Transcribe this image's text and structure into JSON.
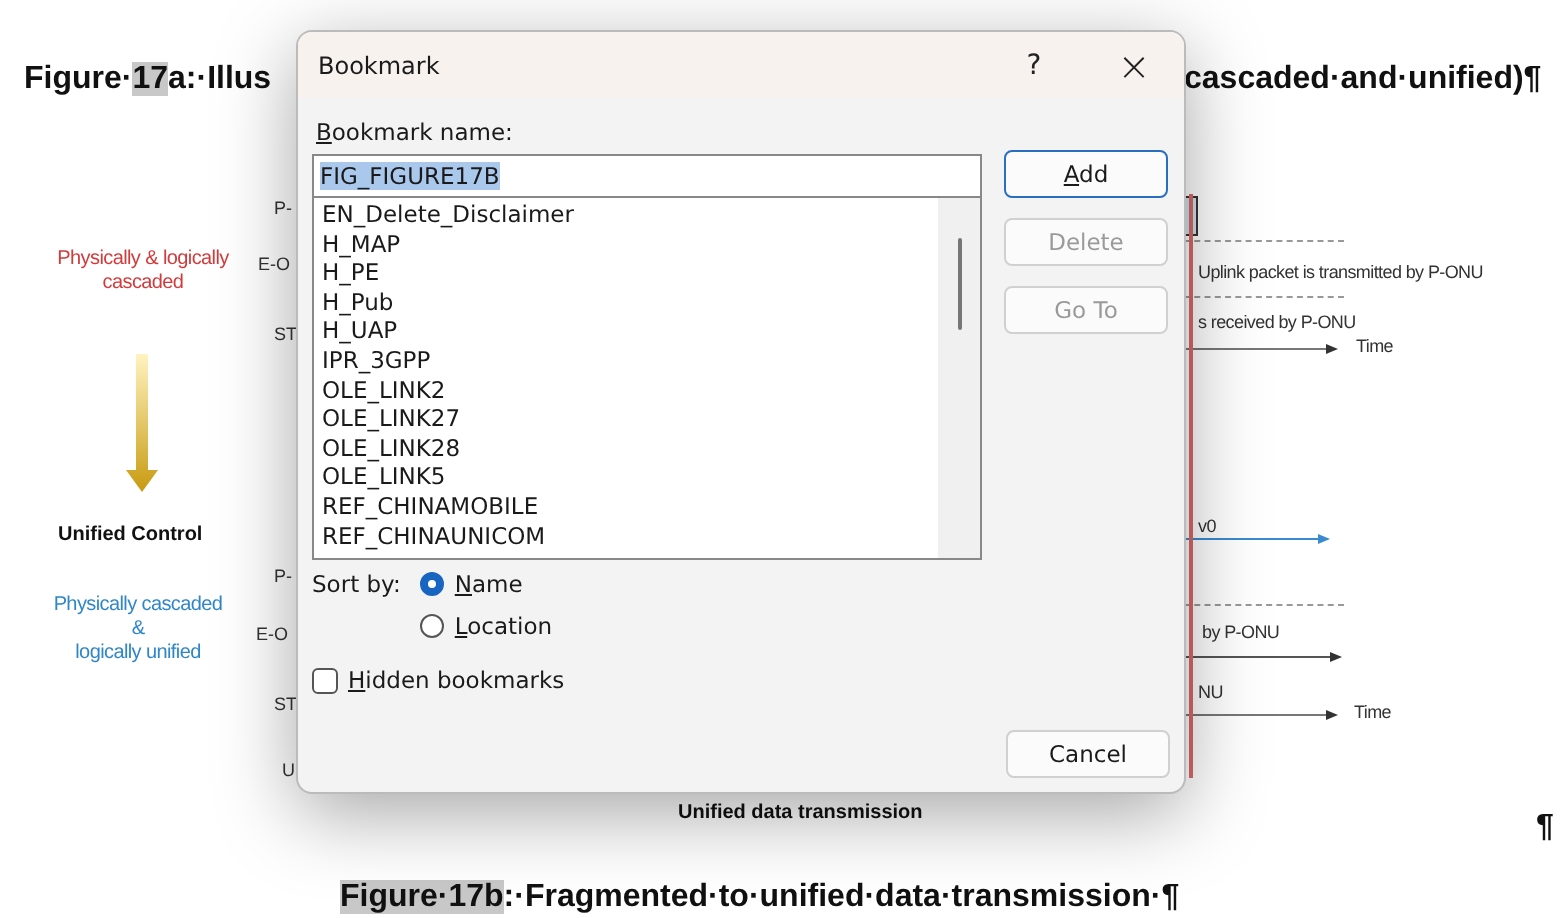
{
  "document": {
    "heading_left": [
      {
        "text": "Figure·",
        "highlighted": false
      },
      {
        "text": "17",
        "highlighted": true
      },
      {
        "text": "a:·Illus",
        "highlighted": false
      }
    ],
    "heading_right": "cascaded·and·unified)¶",
    "red_note": "Physically & logically\ncascaded",
    "unified_control": "Unified Control",
    "blue_note": "Physically cascaded\n&\nlogically unified",
    "upper_row_labels": [
      "P-",
      "E-O",
      "ST"
    ],
    "lower_row_labels": [
      "P-",
      "E-O",
      "ST",
      "U"
    ],
    "upper_notes": [
      "Uplink packet is transmitted by P-ONU",
      "s received by P-ONU"
    ],
    "upper_time": "Time",
    "lower_notes": [
      "v0",
      "by P-ONU",
      "NU"
    ],
    "lower_time": "Time",
    "figure_title": "Unified data transmission",
    "pilcrow": "¶",
    "caption": [
      {
        "text": "Figure·17b",
        "highlighted": true
      },
      {
        "text": ":·Fragmented·to·unified·data·transmission·¶",
        "highlighted": false
      }
    ]
  },
  "dialog": {
    "title": "Bookmark",
    "help": "?",
    "close": "×",
    "name_label": [
      "B",
      "ookmark name:"
    ],
    "name_field": {
      "value": "FIG_FIGURE17B",
      "text_selected": true
    },
    "bookmarks": [
      "EN_Delete_Disclaimer",
      "H_MAP",
      "H_PE",
      "H_Pub",
      "H_UAP",
      "IPR_3GPP",
      "OLE_LINK2",
      "OLE_LINK27",
      "OLE_LINK28",
      "OLE_LINK5",
      "REF_CHINAMOBILE",
      "REF_CHINAUNICOM"
    ],
    "buttons": [
      {
        "label": [
          "A",
          "dd"
        ],
        "disabled": false,
        "default": true
      },
      {
        "label": [
          "Delete"
        ],
        "disabled": true,
        "default": false
      },
      {
        "label": [
          "Go To"
        ],
        "disabled": true,
        "default": false
      }
    ],
    "sort_label": "Sort by:",
    "sort_options": [
      {
        "label": [
          "N",
          "ame"
        ],
        "selected": true
      },
      {
        "label": [
          "L",
          "ocation"
        ],
        "selected": false
      }
    ],
    "hidden_bookmarks": {
      "label": [
        "H",
        "idden bookmarks"
      ],
      "checked": false
    },
    "cancel": "Cancel"
  }
}
